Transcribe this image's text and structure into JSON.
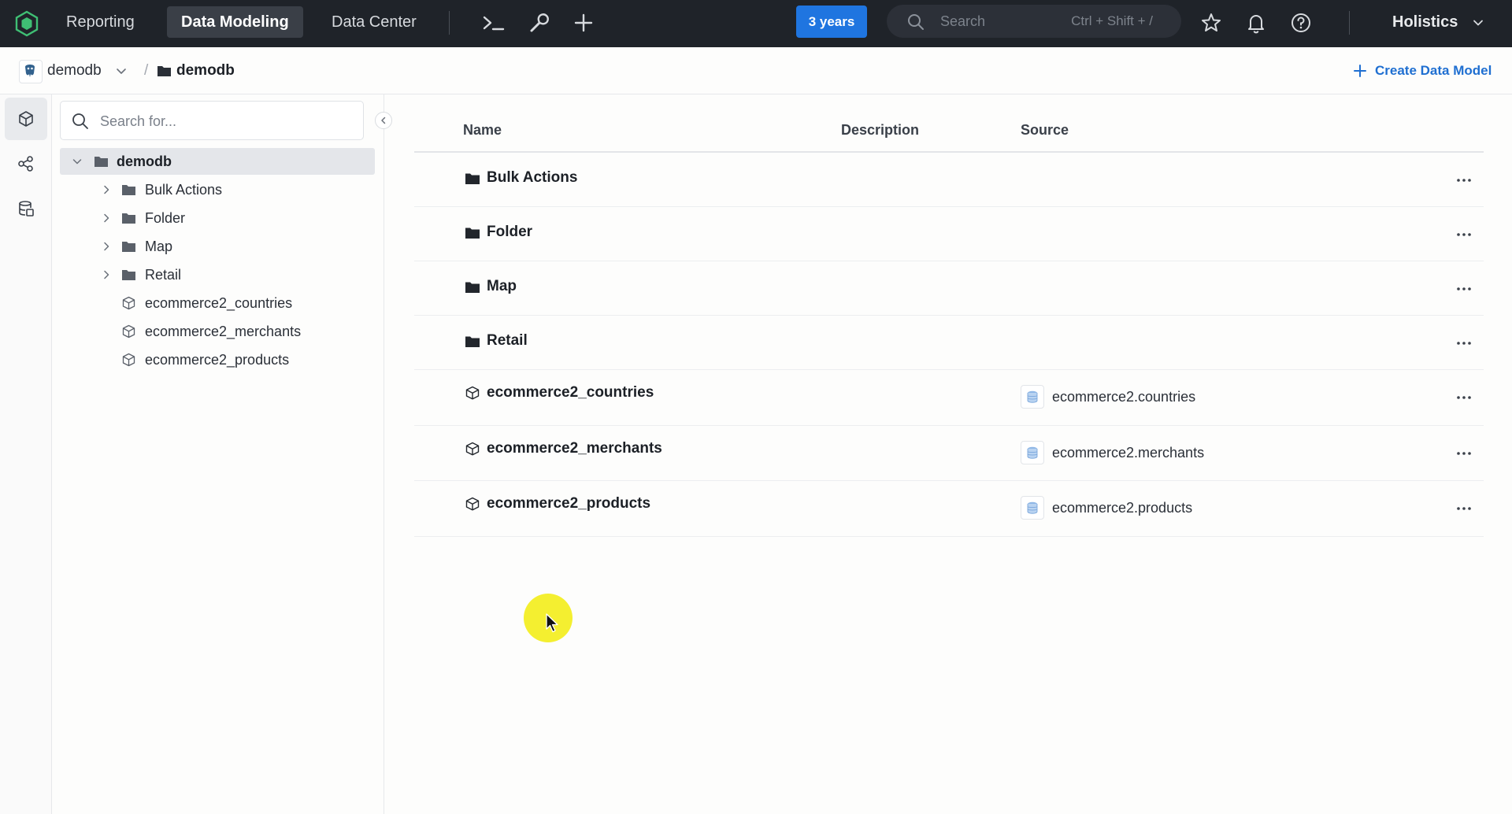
{
  "topbar": {
    "nav": [
      {
        "label": "Reporting",
        "active": false
      },
      {
        "label": "Data Modeling",
        "active": true
      },
      {
        "label": "Data Center",
        "active": false
      }
    ],
    "badge": "3 years",
    "search": {
      "placeholder": "Search",
      "shortcut": "Ctrl + Shift + /"
    },
    "workspace": "Holistics",
    "icons": [
      "terminal-icon",
      "wrench-icon",
      "plus-icon",
      "star-icon",
      "bell-icon",
      "help-icon"
    ]
  },
  "breadcrumb": {
    "datasource": "demodb",
    "separator": "/",
    "current": "demodb",
    "create_label": "Create Data Model"
  },
  "tree": {
    "search_placeholder": "Search for...",
    "root": "demodb",
    "folders": [
      "Bulk Actions",
      "Folder",
      "Map",
      "Retail"
    ],
    "models": [
      "ecommerce2_countries",
      "ecommerce2_merchants",
      "ecommerce2_products"
    ]
  },
  "table": {
    "headers": {
      "name": "Name",
      "description": "Description",
      "source": "Source"
    },
    "rows": [
      {
        "type": "folder",
        "name": "Bulk Actions",
        "description": "",
        "source": ""
      },
      {
        "type": "folder",
        "name": "Folder",
        "description": "",
        "source": ""
      },
      {
        "type": "folder",
        "name": "Map",
        "description": "",
        "source": ""
      },
      {
        "type": "folder",
        "name": "Retail",
        "description": "",
        "source": ""
      },
      {
        "type": "model",
        "name": "ecommerce2_countries",
        "description": "",
        "source": "ecommerce2.countries"
      },
      {
        "type": "model",
        "name": "ecommerce2_merchants",
        "description": "",
        "source": "ecommerce2.merchants"
      },
      {
        "type": "model",
        "name": "ecommerce2_products",
        "description": "",
        "source": "ecommerce2.products"
      }
    ]
  },
  "colors": {
    "accent": "#1f75e0",
    "topbar": "#1f2329",
    "link": "#1f6fd1"
  }
}
